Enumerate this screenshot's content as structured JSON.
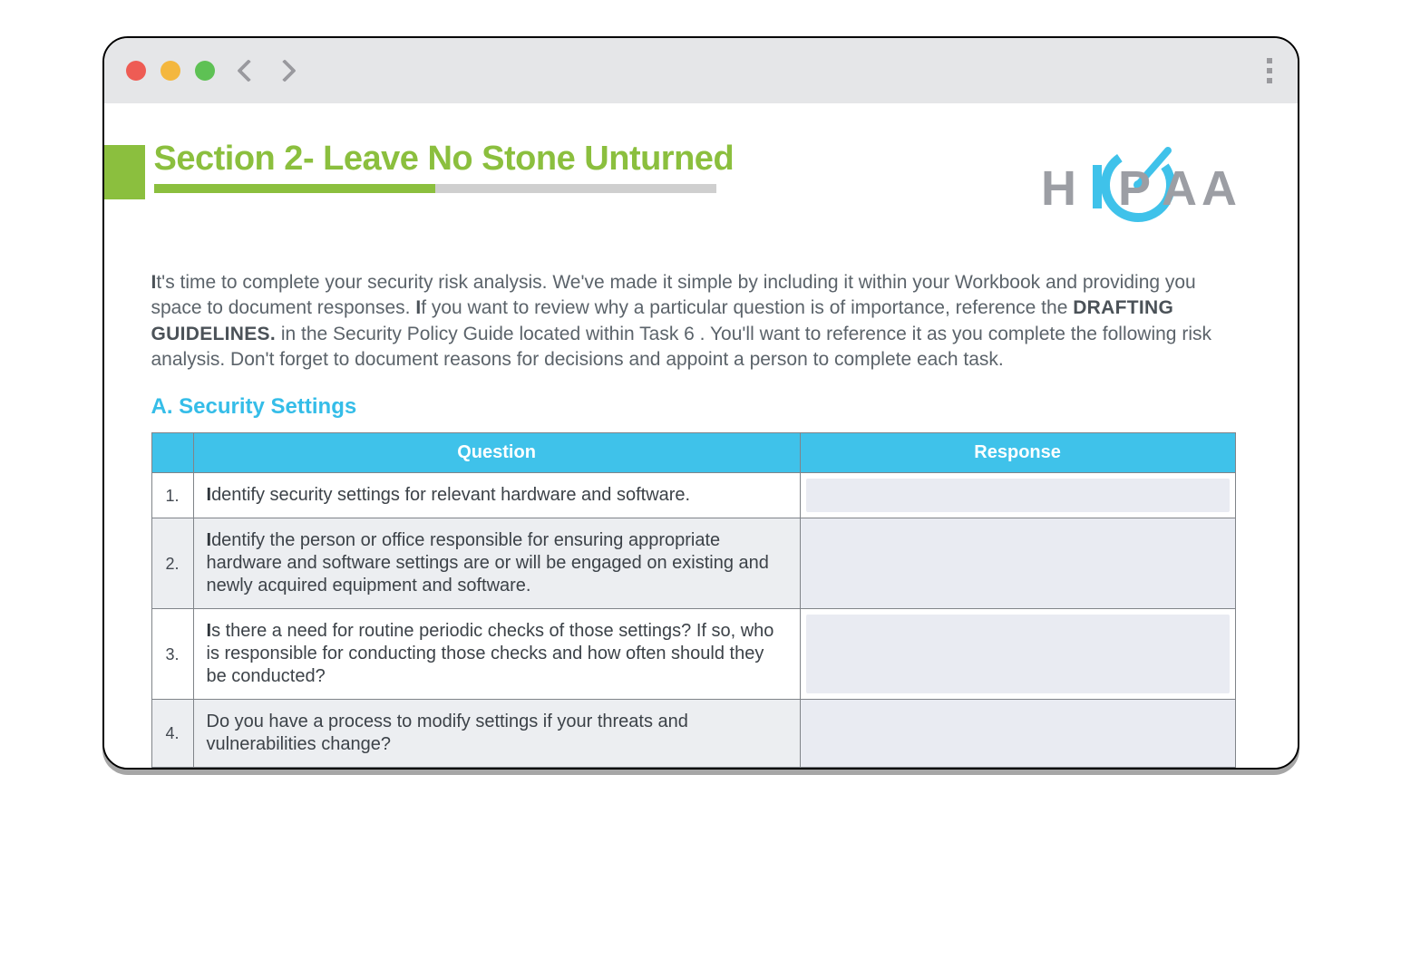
{
  "section": {
    "title": "Section 2- Leave No Stone Unturned",
    "progress_percent": 50
  },
  "logo": {
    "text": "HIPAA",
    "accent_number": "10"
  },
  "intro": {
    "p1a": "I",
    "p1b": "t's time to complete your security risk analysis. We've made it simple by including it within your Workbook and providing you space to document responses. ",
    "p1c": "I",
    "p1d": "f you want to review why a particular question is of importance, reference the ",
    "drafting": "DRAFTING GUIDELINES.",
    "p1e": " in the Security Policy Guide located within Task 6 . You'll want to reference it as you complete the following risk analysis. Don't forget to document reasons for decisions and appoint a person to complete each task."
  },
  "subsection": {
    "label": "A. Security Settings"
  },
  "table": {
    "headers": {
      "number": "",
      "question": "Question",
      "response": "Response"
    },
    "rows": [
      {
        "num": "1.",
        "lead": "I",
        "rest": "dentify security settings for relevant hardware and software.",
        "response": ""
      },
      {
        "num": "2.",
        "lead": "I",
        "rest": "dentify the person or office responsible for ensuring appropriate hardware and software settings are or will be engaged on existing and newly acquired equipment and software.",
        "response": ""
      },
      {
        "num": "3.",
        "lead": "I",
        "rest": "s there a need for routine periodic checks of those settings? If so, who is responsible for conducting those checks and how often should they be conducted?",
        "response": ""
      },
      {
        "num": "4.",
        "lead": " ",
        "rest": "Do you have a process to modify settings if your threats and vulnerabilities change?",
        "response": ""
      }
    ]
  }
}
